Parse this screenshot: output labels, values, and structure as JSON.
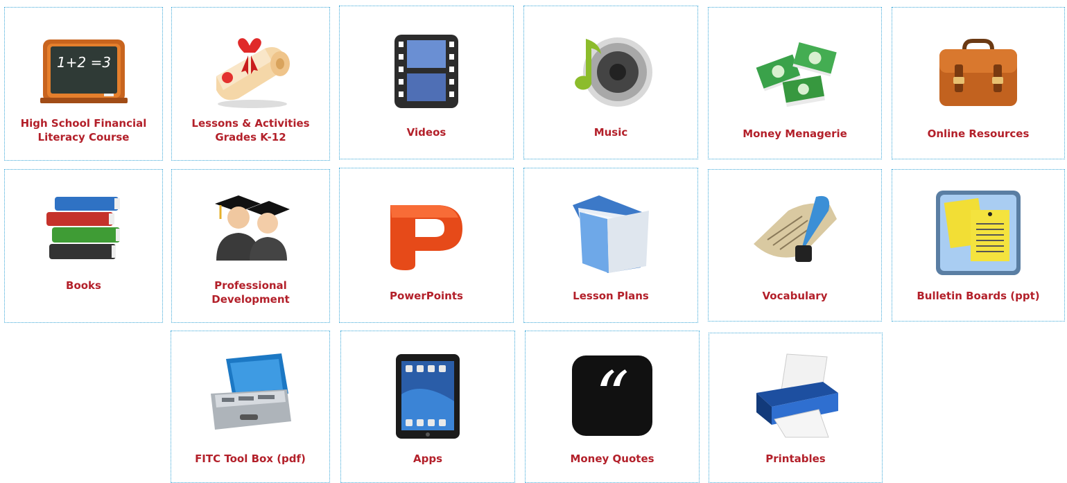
{
  "tiles": [
    {
      "label": "High School Financial Literacy Course",
      "icon": "chalkboard-icon"
    },
    {
      "label": "Lessons & Activities Grades K-12",
      "icon": "diploma-icon"
    },
    {
      "label": "Videos",
      "icon": "film-strip-icon"
    },
    {
      "label": "Music",
      "icon": "speaker-music-note-icon"
    },
    {
      "label": "Money Menagerie",
      "icon": "cash-stacks-icon"
    },
    {
      "label": "Online Resources",
      "icon": "briefcase-icon"
    },
    {
      "label": "Books",
      "icon": "book-stack-icon"
    },
    {
      "label": "Professional Development",
      "icon": "graduates-icon"
    },
    {
      "label": "PowerPoints",
      "icon": "powerpoint-icon"
    },
    {
      "label": "Lesson Plans",
      "icon": "folder-icon"
    },
    {
      "label": "Vocabulary",
      "icon": "quill-scroll-icon"
    },
    {
      "label": "Bulletin Boards (ppt)",
      "icon": "bulletin-board-icon"
    },
    {
      "label": "FITC Tool Box (pdf)",
      "icon": "toolbox-icon"
    },
    {
      "label": "Apps",
      "icon": "tablet-icon"
    },
    {
      "label": "Money Quotes",
      "icon": "quote-icon"
    },
    {
      "label": "Printables",
      "icon": "printer-icon"
    }
  ],
  "chalkboard_text": "1+2 =3",
  "colors": {
    "label": "#b3202a",
    "border": "#3aa7d8"
  }
}
